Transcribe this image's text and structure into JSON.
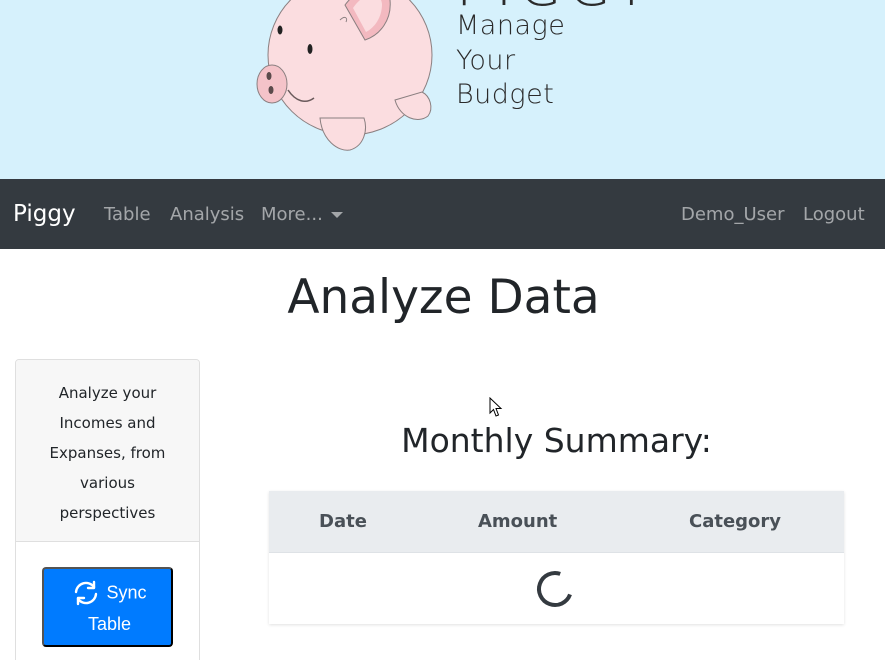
{
  "banner": {
    "logo_word": "PIGGY",
    "tagline": [
      "Manage",
      "Your",
      "Budget"
    ]
  },
  "navbar": {
    "brand": "Piggy",
    "links": [
      {
        "label": "Table"
      },
      {
        "label": "Analysis"
      },
      {
        "label": "More..."
      }
    ],
    "user": "Demo_User",
    "logout": "Logout"
  },
  "page": {
    "title": "Analyze Data"
  },
  "sidebar": {
    "description": "Analyze your Incomes and Expanses, from various perspectives",
    "sync_button": {
      "line1": "Sync",
      "line2": "Table",
      "icon": "sync-icon"
    }
  },
  "summary": {
    "title": "Monthly Summary:",
    "columns": [
      "Date",
      "Amount",
      "Category"
    ],
    "loading": true
  },
  "colors": {
    "banner_bg": "#d6f1fc",
    "navbar_bg": "#343a40",
    "primary": "#007bff",
    "table_head_bg": "#e9ecef",
    "pig_pink": "#fbdde0"
  }
}
